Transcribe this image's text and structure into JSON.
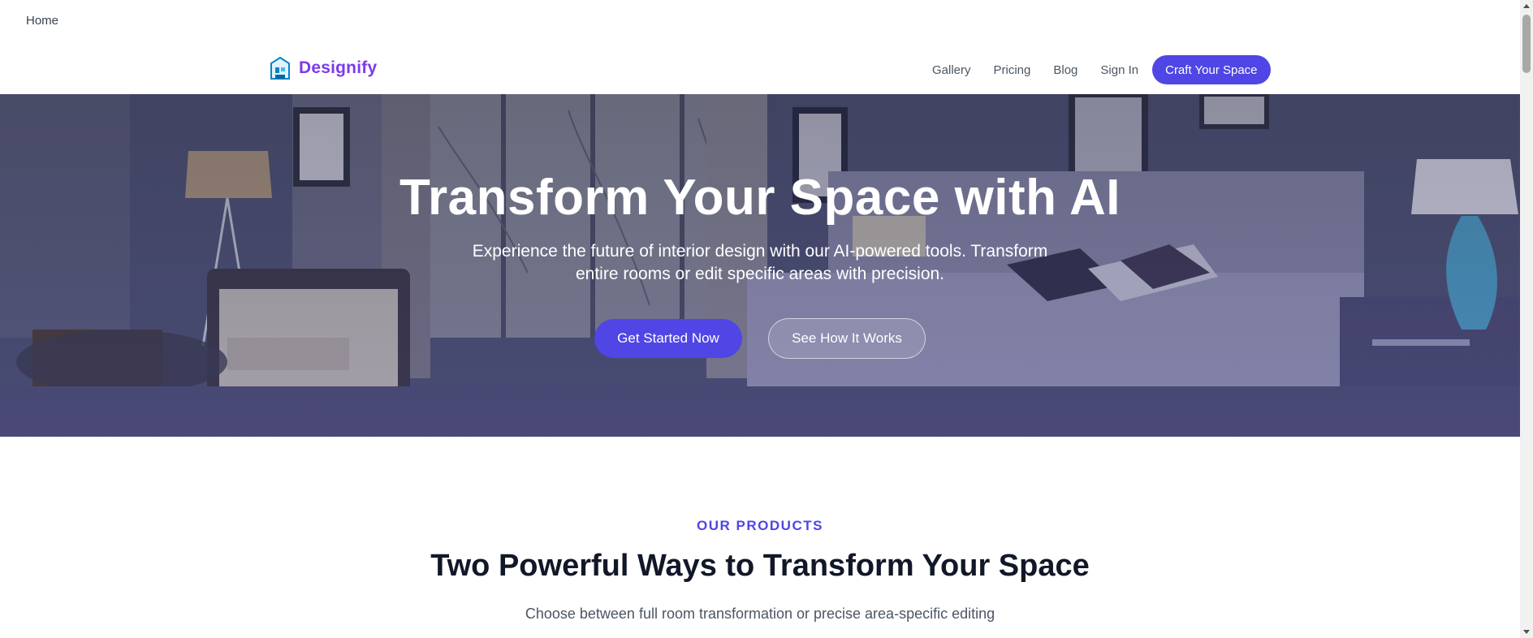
{
  "breadcrumb": {
    "label": "Home"
  },
  "brand": {
    "name": "Designify",
    "logo_icon": "house-icon",
    "color": "#7c3aed"
  },
  "nav": {
    "links": [
      "Gallery",
      "Pricing",
      "Blog",
      "Sign In"
    ],
    "cta_label": "Craft Your Space"
  },
  "hero": {
    "title": "Transform Your Space with AI",
    "subtitle": "Experience the future of interior design with our AI-powered tools. Transform entire rooms or edit specific areas with precision.",
    "primary_button": "Get Started Now",
    "secondary_button": "See How It Works"
  },
  "products": {
    "eyebrow": "OUR PRODUCTS",
    "title": "Two Powerful Ways to Transform Your Space",
    "subtitle": "Choose between full room transformation or precise area-specific editing"
  },
  "colors": {
    "accent": "#4f46e5",
    "brand_text": "#7c3aed",
    "heading": "#111827"
  }
}
